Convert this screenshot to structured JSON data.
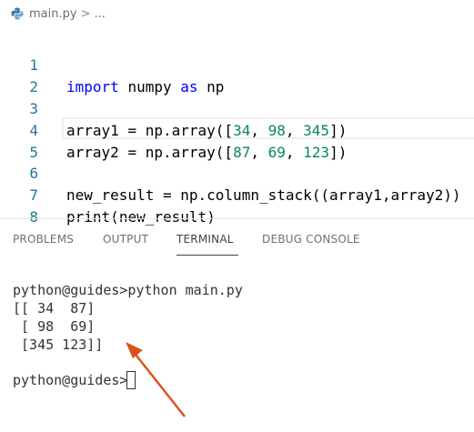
{
  "breadcrumb": {
    "file": "main.py",
    "separator": ">",
    "more": "..."
  },
  "editor": {
    "lines": [
      {
        "number": "1",
        "text": "import numpy as np"
      },
      {
        "number": "2",
        "text": ""
      },
      {
        "number": "3",
        "text": "array1 = np.array([34, 98, 345])"
      },
      {
        "number": "4",
        "text": "array2 = np.array([87, 69, 123])"
      },
      {
        "number": "5",
        "text": ""
      },
      {
        "number": "6",
        "text": "new_result = np.column_stack((array1,array2))"
      },
      {
        "number": "7",
        "text": "print(new_result)"
      },
      {
        "number": "8",
        "text": ""
      }
    ]
  },
  "panel": {
    "tabs": [
      {
        "label": "PROBLEMS",
        "active": false
      },
      {
        "label": "OUTPUT",
        "active": false
      },
      {
        "label": "TERMINAL",
        "active": true
      },
      {
        "label": "DEBUG CONSOLE",
        "active": false
      }
    ]
  },
  "terminal": {
    "lines": [
      "python@guides>python main.py",
      "[[ 34  87]",
      " [ 98  69]",
      " [345 123]]",
      "",
      "python@guides>"
    ]
  },
  "colors": {
    "keyword": "#0000ff",
    "number": "#098658",
    "line_number": "#237893",
    "arrow": "#d9531e"
  },
  "icons": {
    "file": "python-icon",
    "annotation": "arrow-annotation"
  }
}
